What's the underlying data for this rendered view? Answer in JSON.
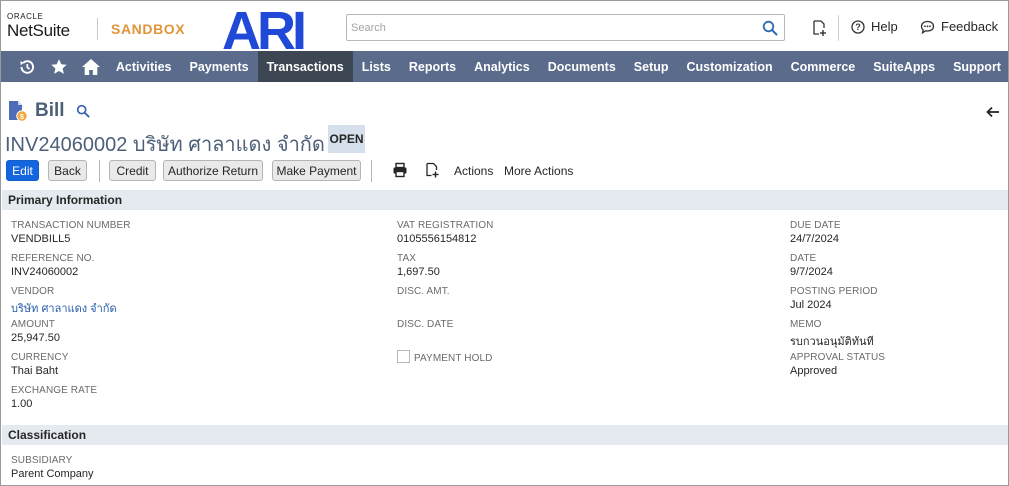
{
  "header": {
    "oracle_text": "ORACLE",
    "product_name": "NetSuite",
    "environment": "SANDBOX",
    "company_logo": "ARI",
    "search_placeholder": "Search",
    "help_label": "Help",
    "feedback_label": "Feedback"
  },
  "nav": {
    "icons": [
      "recent-records-icon",
      "star-icon",
      "home-icon"
    ],
    "items": [
      "Activities",
      "Payments",
      "Transactions",
      "Lists",
      "Reports",
      "Analytics",
      "Documents",
      "Setup",
      "Customization",
      "Commerce",
      "SuiteApps",
      "Support"
    ],
    "active": "Transactions"
  },
  "page": {
    "record_type": "Bill",
    "record_name": "INV24060002 บริษัท ศาลาแดง จำกัด",
    "status": "OPEN"
  },
  "buttons": {
    "edit": "Edit",
    "back": "Back",
    "credit": "Credit",
    "authorize_return": "Authorize Return",
    "make_payment": "Make Payment",
    "actions": "Actions",
    "more_actions": "More Actions"
  },
  "primary": {
    "title": "Primary Information",
    "col1": [
      {
        "label": "TRANSACTION NUMBER",
        "value": "VENDBILL5"
      },
      {
        "label": "REFERENCE NO.",
        "value": "INV24060002"
      },
      {
        "label": "VENDOR",
        "value": "บริษัท ศาลาแดง จำกัด"
      },
      {
        "label": "AMOUNT",
        "value": "25,947.50"
      },
      {
        "label": "CURRENCY",
        "value": "Thai Baht"
      },
      {
        "label": "EXCHANGE RATE",
        "value": "1.00"
      }
    ],
    "col2": [
      {
        "label": "VAT REGISTRATION",
        "value": "0105556154812"
      },
      {
        "label": "TAX",
        "value": "1,697.50"
      },
      {
        "label": "DISC. AMT.",
        "value": ""
      },
      {
        "label": "DISC. DATE",
        "value": ""
      }
    ],
    "payment_hold_label": "PAYMENT HOLD",
    "col3": [
      {
        "label": "DUE DATE",
        "value": "24/7/2024"
      },
      {
        "label": "DATE",
        "value": "9/7/2024"
      },
      {
        "label": "POSTING PERIOD",
        "value": "Jul 2024"
      },
      {
        "label": "MEMO",
        "value": "รบกวนอนุมัติทันที"
      },
      {
        "label": "APPROVAL STATUS",
        "value": "Approved"
      }
    ]
  },
  "classification": {
    "title": "Classification",
    "subsidiary_label": "SUBSIDIARY",
    "subsidiary_value": "Parent Company"
  },
  "colors": {
    "nav_bg": "#5a6b8c",
    "nav_active": "#3d4653",
    "title_color": "#4d5f79",
    "sandbox_color": "#e0953a",
    "logo_blue": "#2049d8",
    "primary_button": "#1466df",
    "section_bar": "#e5e9f0",
    "status_badge": "#d5e0ec",
    "link": "#255ba8"
  }
}
